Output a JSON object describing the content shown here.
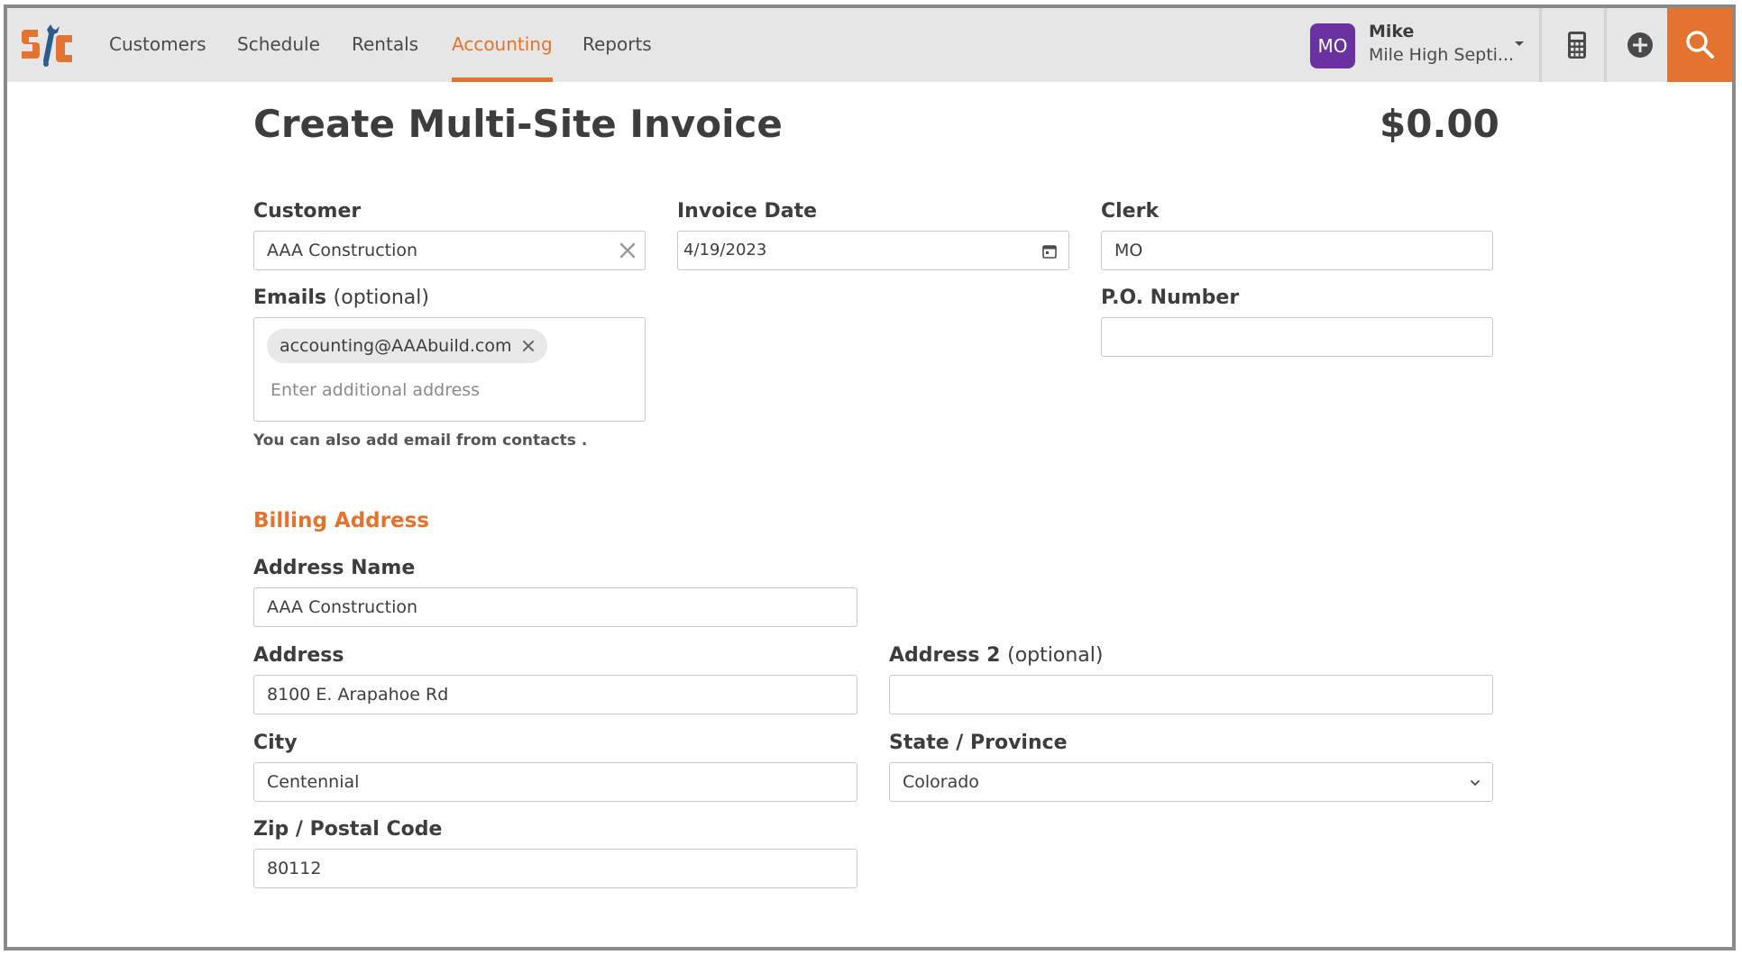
{
  "nav": {
    "logo_icon": "sc-wrench-logo",
    "items": [
      {
        "label": "Customers",
        "active": false
      },
      {
        "label": "Schedule",
        "active": false
      },
      {
        "label": "Rentals",
        "active": false
      },
      {
        "label": "Accounting",
        "active": true
      },
      {
        "label": "Reports",
        "active": false
      }
    ],
    "user": {
      "initials": "MO",
      "name": "Mike",
      "company": "Mile High Septi..."
    },
    "icons": [
      "calculator-icon",
      "plus-circle-icon",
      "search-icon"
    ]
  },
  "page": {
    "title": "Create Multi-Site Invoice",
    "total": "$0.00"
  },
  "form": {
    "customer": {
      "label": "Customer",
      "value": "AAA Construction"
    },
    "invoice_date": {
      "label": "Invoice Date",
      "value": "4/19/2023"
    },
    "clerk": {
      "label": "Clerk",
      "value": "MO"
    },
    "emails": {
      "label": "Emails",
      "optional": "(optional)",
      "chips": [
        "accounting@AAAbuild.com"
      ],
      "placeholder": "Enter additional address",
      "help": "You can also add email from contacts ."
    },
    "po_number": {
      "label": "P.O. Number",
      "value": ""
    }
  },
  "billing": {
    "title": "Billing Address",
    "address_name": {
      "label": "Address Name",
      "value": "AAA Construction"
    },
    "address": {
      "label": "Address",
      "value": "8100 E. Arapahoe Rd"
    },
    "address2": {
      "label": "Address 2",
      "optional": "(optional)",
      "value": ""
    },
    "city": {
      "label": "City",
      "value": "Centennial"
    },
    "state": {
      "label": "State / Province",
      "value": "Colorado"
    },
    "zip": {
      "label": "Zip / Postal Code",
      "value": "80112"
    }
  },
  "colors": {
    "accent": "#e2742f",
    "avatar": "#6a31a0",
    "topbar": "#e6e6e6"
  }
}
